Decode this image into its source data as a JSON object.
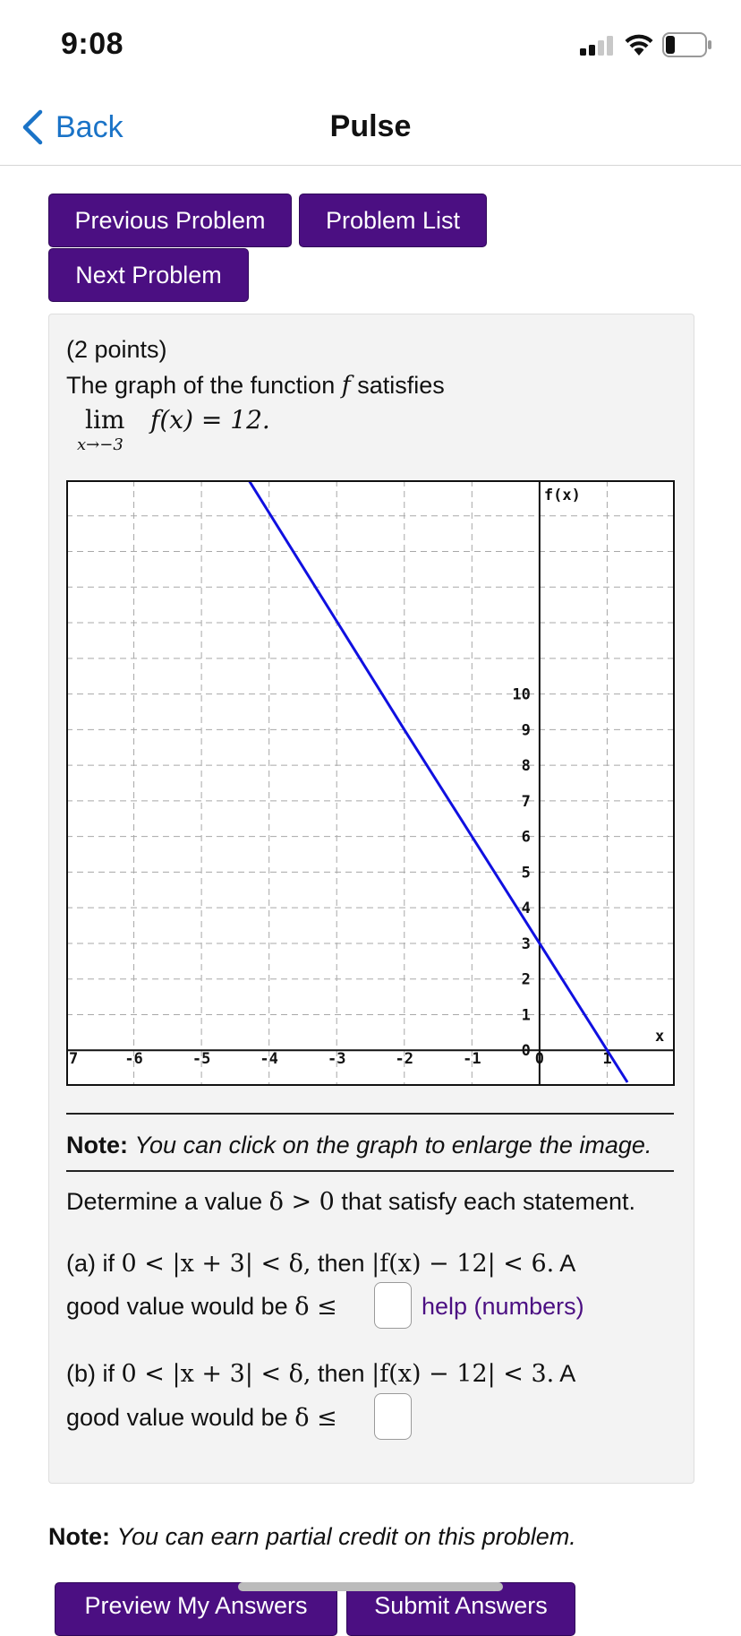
{
  "status_bar": {
    "time": "9:08",
    "signal_icon": "cellular-signal-icon",
    "wifi_icon": "wifi-icon",
    "battery_icon": "battery-icon"
  },
  "nav": {
    "back_label": "Back",
    "title": "Pulse",
    "back_icon": "chevron-left-icon"
  },
  "buttons": {
    "previous": "Previous Problem",
    "list": "Problem List",
    "next": "Next Problem",
    "preview": "Preview My Answers",
    "submit": "Submit Answers"
  },
  "problem": {
    "points": "(2 points)",
    "intro": "The graph of the function",
    "func": "f",
    "intro_end": "satisfies",
    "limit_word": "lim",
    "limit_sub": "x→−3",
    "limit_expr": "f(x) = 12.",
    "graph_note_bold": "Note:",
    "graph_note": "You can click on the graph to enlarge the image.",
    "determine_a": "Determine a value",
    "determine_math": "δ > 0",
    "determine_b": "that satisfy each statement.",
    "part_a_1": "(a) if",
    "part_a_cond": "0 < |x + 3| < δ,",
    "part_a_then": "then",
    "part_a_ineq": "|f(x) − 12| < 6.",
    "part_a_A": "A",
    "part_a_2": "good value would be",
    "part_a_delta": "δ ≤",
    "part_a_value": "",
    "help_text": "help (numbers)",
    "part_b_1": "(b) if",
    "part_b_cond": "0 < |x + 3| < δ,",
    "part_b_then": "then",
    "part_b_ineq": "|f(x) − 12| < 3.",
    "part_b_A": "A",
    "part_b_2": "good value would be",
    "part_b_delta": "δ ≤",
    "part_b_value": ""
  },
  "footer_note": {
    "bold": "Note:",
    "text": "You can earn partial credit on this problem."
  },
  "colors": {
    "accent": "#4b0f82",
    "link": "#1a73c7",
    "curve": "#1010e0"
  },
  "chart_data": {
    "type": "line",
    "ylabel": "f(x)",
    "xlabel": "x",
    "xlim": [
      -7,
      2
    ],
    "ylim": [
      -1,
      16
    ],
    "grid": true,
    "x_ticks": [
      "7",
      "-6",
      "-5",
      "-4",
      "-3",
      "-2",
      "-1",
      "0",
      "1"
    ],
    "y_ticks": [
      "0",
      "1",
      "2",
      "3",
      "4",
      "5",
      "6",
      "7",
      "8",
      "9",
      "10"
    ],
    "series": [
      {
        "points": [
          [
            -4.3,
            16
          ],
          [
            -2,
            9
          ],
          [
            0,
            3
          ],
          [
            1,
            0
          ],
          [
            1.3,
            -0.9
          ]
        ]
      }
    ]
  }
}
